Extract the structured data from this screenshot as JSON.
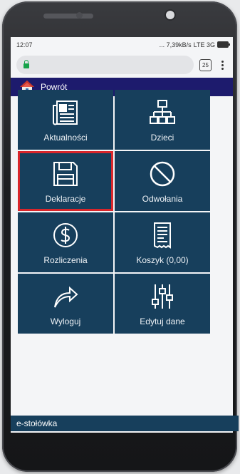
{
  "status_bar": {
    "time": "12:07",
    "indicators": "... 7,39kB/s",
    "network": "LTE 3G"
  },
  "browser": {
    "tabs_count": "25",
    "lock_icon": "lock-icon",
    "menu_icon": "more-vert-icon"
  },
  "header": {
    "back_label": "Powrót",
    "home_icon": "home-icon"
  },
  "tiles": [
    {
      "label": "Aktualności",
      "icon": "newspaper-icon"
    },
    {
      "label": "Dzieci",
      "icon": "org-chart-icon"
    },
    {
      "label": "Deklaracje",
      "icon": "floppy-disk-icon"
    },
    {
      "label": "Odwołania",
      "icon": "prohibited-icon"
    },
    {
      "label": "Rozliczenia",
      "icon": "dollar-coin-icon"
    },
    {
      "label": "Koszyk (0,00)",
      "icon": "receipt-icon"
    },
    {
      "label": "Wyloguj",
      "icon": "share-arrow-icon"
    },
    {
      "label": "Edytuj dane",
      "icon": "sliders-icon"
    }
  ],
  "footer": {
    "text": "e-stołówka"
  },
  "colors": {
    "header_bg": "#1d1b6d",
    "tile_bg": "#173f5c",
    "highlight": "#d9262b",
    "footer_bg": "#173f5c"
  }
}
